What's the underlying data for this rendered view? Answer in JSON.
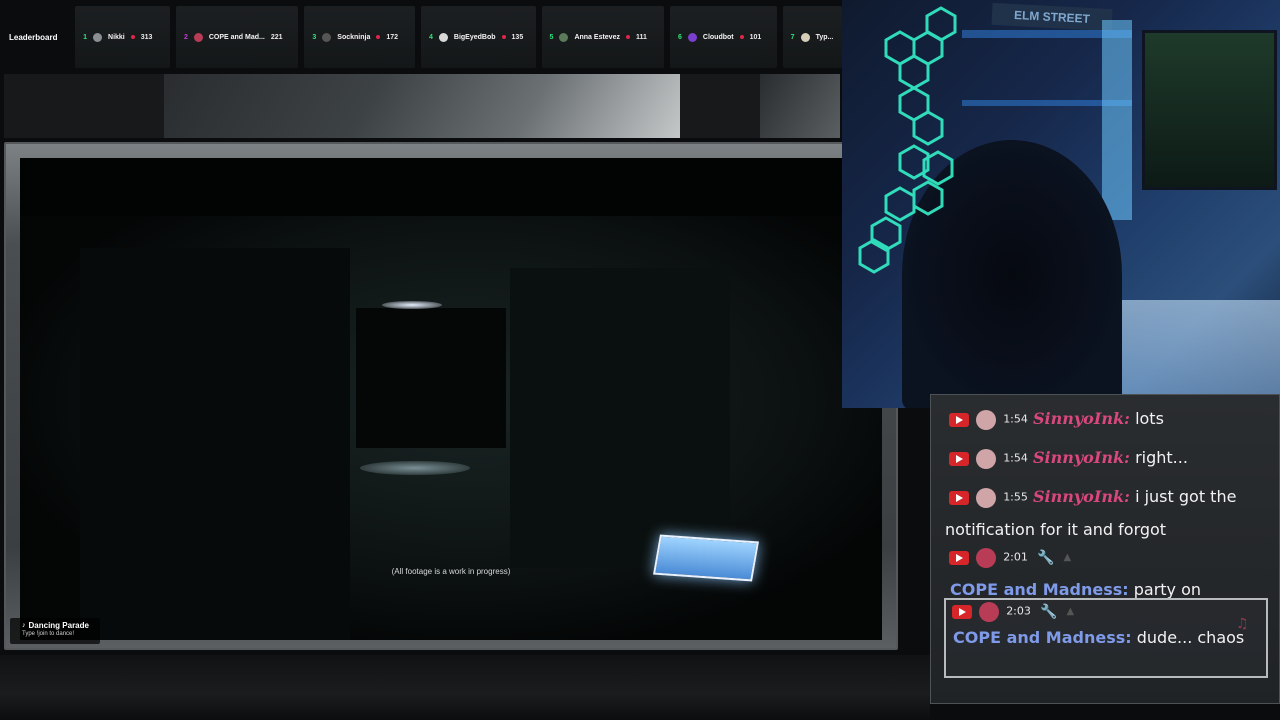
{
  "leaderboard": {
    "title": "Leaderboard",
    "entries": [
      {
        "rank": "1",
        "name": "Nikki",
        "score": "313"
      },
      {
        "rank": "2",
        "name": "COPE and Mad...",
        "score": "221"
      },
      {
        "rank": "3",
        "name": "Sockninja",
        "score": "172"
      },
      {
        "rank": "4",
        "name": "BigEyedBob",
        "score": "135"
      },
      {
        "rank": "5",
        "name": "Anna Estevez",
        "score": "111"
      },
      {
        "rank": "6",
        "name": "Cloudbot",
        "score": "101"
      },
      {
        "rank": "7",
        "name": "Typ..."
      }
    ]
  },
  "game": {
    "caption": "(All footage is a work in progress)"
  },
  "dancing_parade": {
    "title": "Dancing Parade",
    "subtitle": "Type !join to dance!"
  },
  "webcam": {
    "sign": "ELM STREET"
  },
  "chat": {
    "messages": [
      {
        "time": "1:54",
        "user": "SinnyoInk:",
        "text": "lots"
      },
      {
        "time": "1:54",
        "user": "SinnyoInk:",
        "text": "right..."
      },
      {
        "time": "1:55",
        "user": "SinnyoInk:",
        "text": "i just got the notification for it and forgot"
      },
      {
        "time": "2:01",
        "user": "COPE and Madness:",
        "text": "party on"
      },
      {
        "time": "2:03",
        "user": "COPE and Madness:",
        "text": "dude... chaos"
      }
    ]
  },
  "colors": {
    "leaderboard_rank": "#2fe37a",
    "sinny_name": "#d9487a",
    "cope_name": "#7e9ae8",
    "youtube_red": "#d7262a",
    "cube_neon": "#35f0c8"
  },
  "icons": {
    "platform": "youtube-icon",
    "moderator": "wrench-icon",
    "dance": "dancer-icon",
    "music": "music-note-icon"
  }
}
